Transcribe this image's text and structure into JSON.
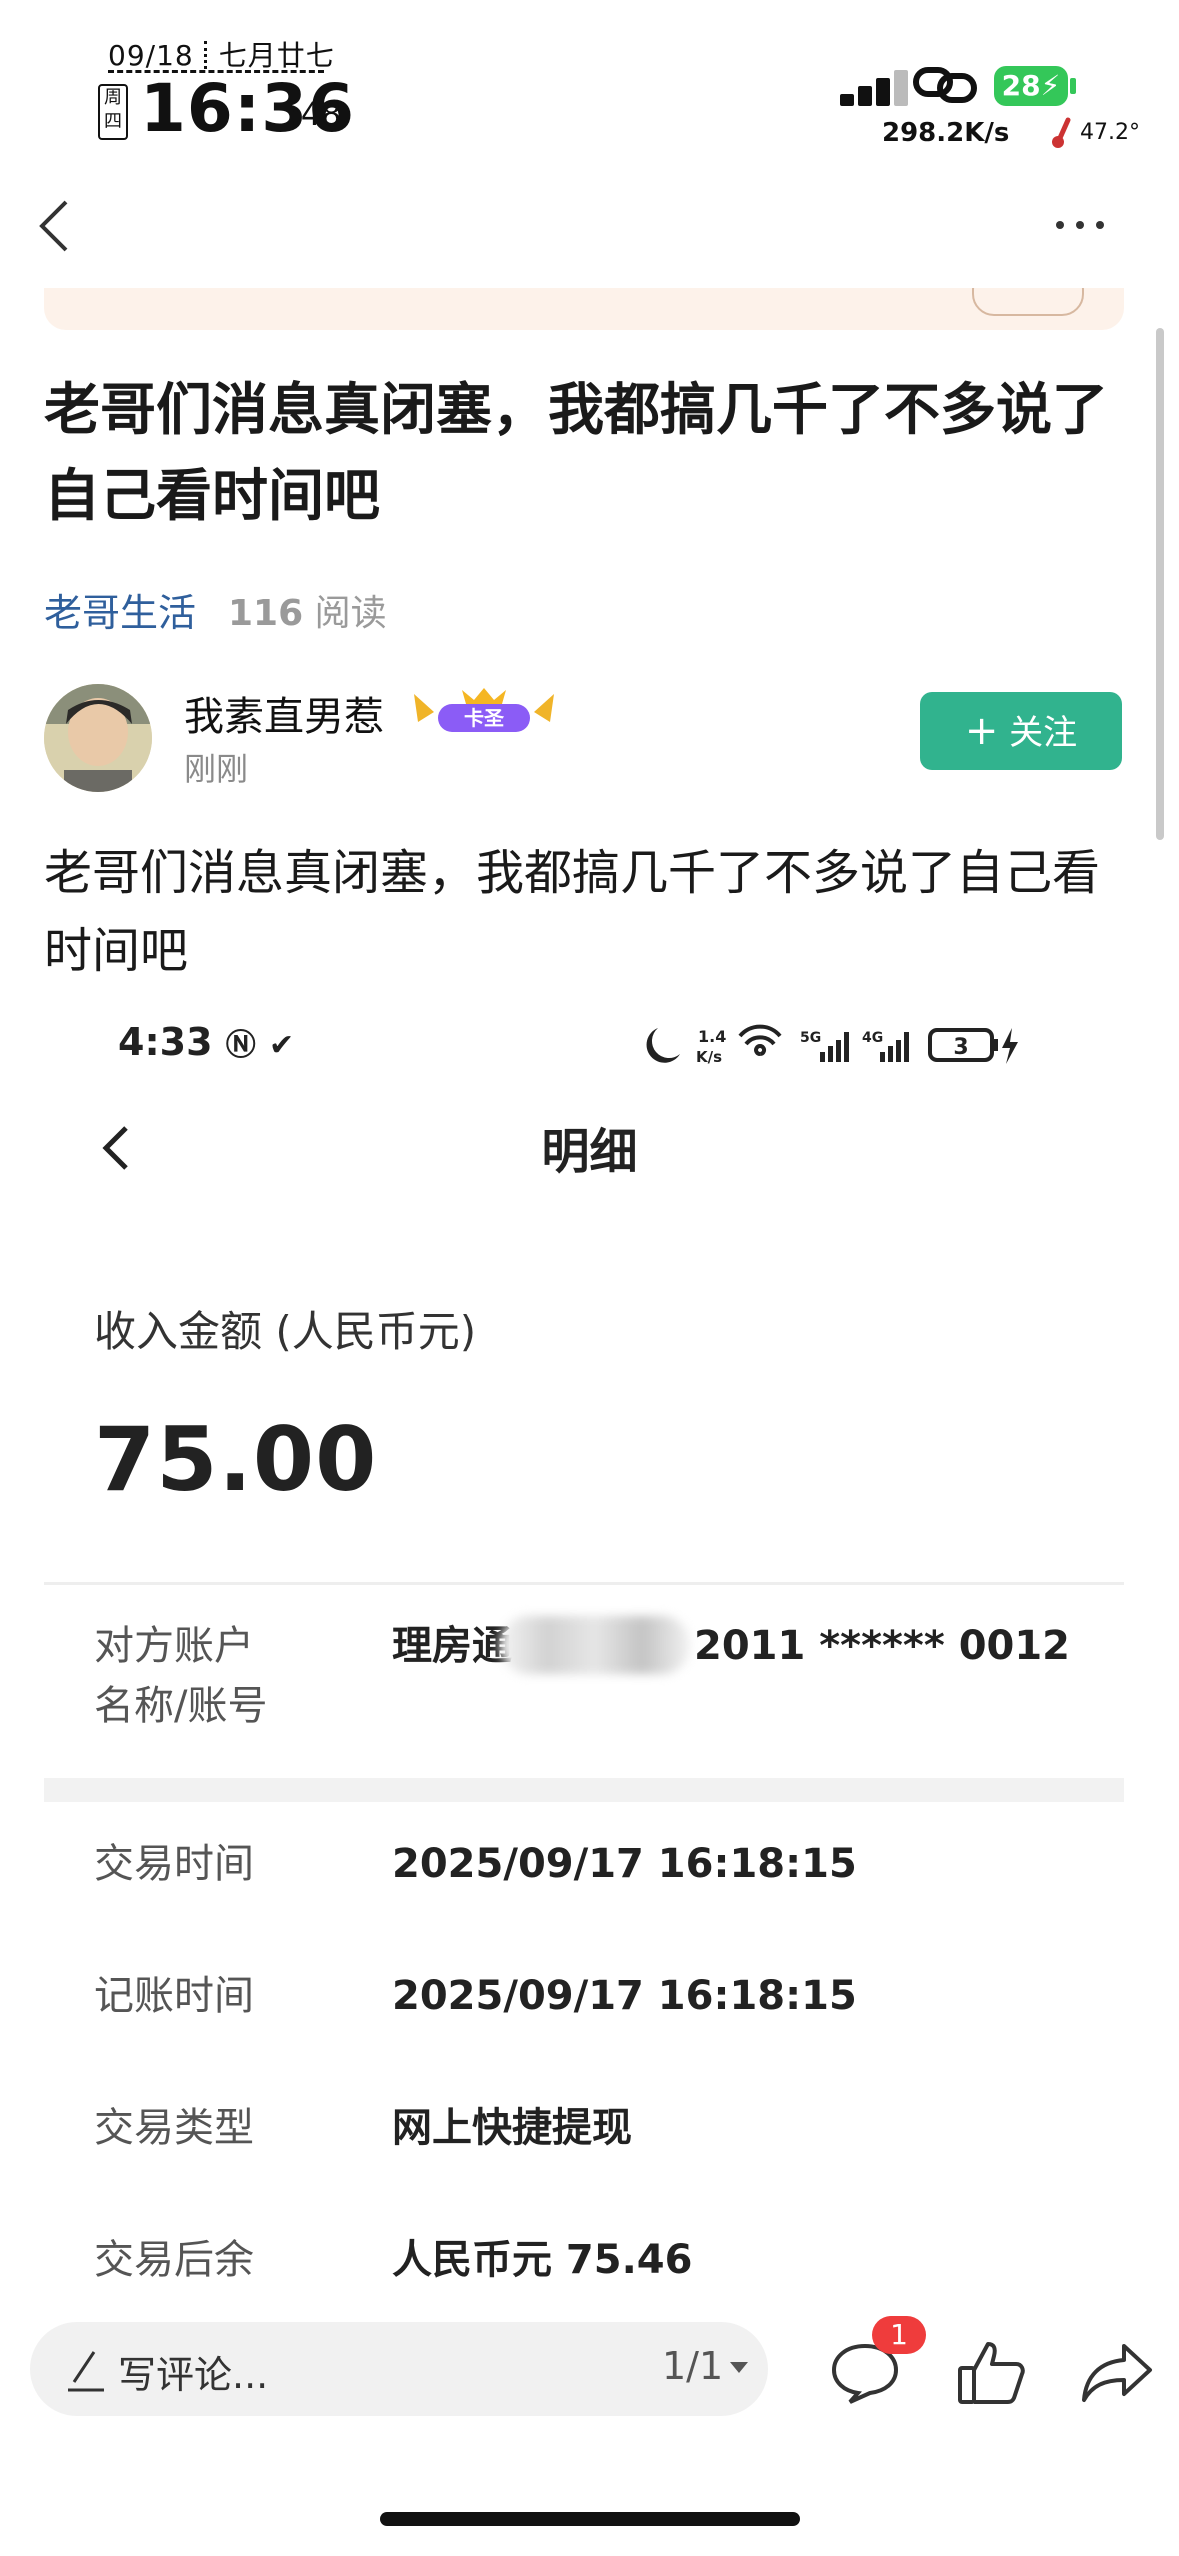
{
  "status_bar": {
    "date": "09/18",
    "lunar_date": "七月廿七",
    "weekday": "周四",
    "time": "16:36",
    "seconds": ":48",
    "net_speed": "298.2K/s",
    "battery": "28",
    "temperature": "47.2°"
  },
  "nav": {
    "back_icon": "chevron-left-icon",
    "more_icon": "more-icon"
  },
  "post": {
    "title": "老哥们消息真闭塞，我都搞几千了不多说了自己看时间吧",
    "circle": "老哥生活",
    "read_count": "116",
    "read_label": "阅读",
    "author": {
      "name": "我素直男惹",
      "badge": "卡圣",
      "time": "刚刚"
    },
    "follow_label": "关注",
    "body": "老哥们消息真闭塞，我都搞几千了不多说了自己看时间吧"
  },
  "embedded_screenshot": {
    "status_time": "4:33",
    "status_speed_top": "1.4",
    "status_speed_unit": "K/s",
    "status_battery": "3",
    "title": "明细",
    "income_label": "收入金额 (人民币元)",
    "income_amount": "75.00",
    "counterparty": {
      "label_line1": "对方账户",
      "label_line2": "名称/账号",
      "value_prefix": "理房通",
      "value_suffix": "2011 ****** 0012"
    },
    "details": [
      {
        "label": "交易时间",
        "value": "2025/09/17 16:18:15"
      },
      {
        "label": "记账时间",
        "value": "2025/09/17 16:18:15"
      },
      {
        "label": "交易类型",
        "value": "网上快捷提现"
      },
      {
        "label": "交易后余",
        "value": "人民币元 75.46"
      }
    ]
  },
  "bottom_bar": {
    "comment_placeholder": "写评论...",
    "page_indicator": "1/1",
    "comment_count": "1"
  },
  "colors": {
    "follow_button": "#31b38e",
    "circle_link": "#2f5f9c",
    "battery": "#34c759",
    "badge": "#ef3c3c"
  }
}
